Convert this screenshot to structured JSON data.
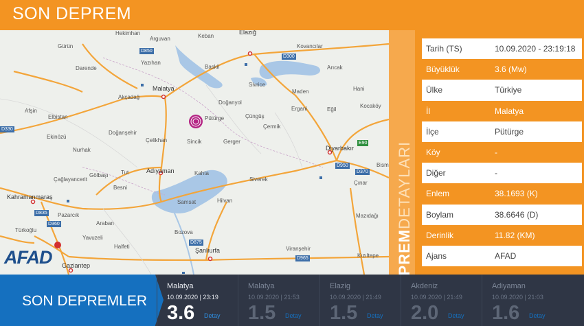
{
  "header": {
    "title": "SON DEPREM"
  },
  "map": {
    "brand": "AFAD",
    "labels": [
      "Hekimhan",
      "Arguvan",
      "Keban",
      "Elazığ",
      "Kovancılar",
      "Gürün",
      "Yazıhan",
      "Baskil",
      "Arıcak",
      "Darende",
      "Malatya",
      "Sivrice",
      "Maden",
      "Hani",
      "Akçadağ",
      "Doğanyol",
      "Ergani",
      "Eğil",
      "Kocaköy",
      "Afşin",
      "Pütürge",
      "Çüngüş",
      "Çermik",
      "Elbistan",
      "Ekinözü",
      "Doğanşehir",
      "Çelikhan",
      "Sincik",
      "Gerger",
      "Diyarbakır",
      "Nurhak",
      "Tut",
      "Adıyaman",
      "Kahta",
      "Bism",
      "Çağlayancerit",
      "Gölbaşı",
      "Besni",
      "Siverek",
      "Çınar",
      "Kahramanmaraş",
      "Hilvan",
      "Samsat",
      "Pazarcık",
      "Mazıdağı",
      "Türkoğlu",
      "Araban",
      "Yavuzeli",
      "Bozova",
      "Halfeti",
      "Viranşehir",
      "Gaziantep",
      "Şanlıurfa",
      "Kızıltepe"
    ],
    "road_badges": [
      "D850",
      "D300",
      "D330",
      "D950",
      "E90",
      "D370",
      "D835",
      "D360",
      "D875",
      "D965"
    ],
    "colors": {
      "background": "#eef0ec",
      "road": "#f3a53a",
      "water": "#a9c7e6",
      "epicenter": "#b0197e"
    }
  },
  "side": {
    "vertical_title_bold": "DEPREM",
    "vertical_title_light": "DETAYLARI"
  },
  "details": [
    {
      "label": "Tarih (TS)",
      "value": "10.09.2020 - 23:19:18"
    },
    {
      "label": "Büyüklük",
      "value": "3.6 (Mw)"
    },
    {
      "label": "Ülke",
      "value": "Türkiye"
    },
    {
      "label": "İl",
      "value": "Malatya"
    },
    {
      "label": "İlçe",
      "value": "Pütürge"
    },
    {
      "label": "Köy",
      "value": "-"
    },
    {
      "label": "Diğer",
      "value": "-"
    },
    {
      "label": "Enlem",
      "value": "38.1693 (K)"
    },
    {
      "label": "Boylam",
      "value": "38.6646 (D)"
    },
    {
      "label": "Derinlik",
      "value": "11.82 (KM)"
    },
    {
      "label": "Ajans",
      "value": "AFAD"
    }
  ],
  "footer": {
    "title": "SON DEPREMLER",
    "detail_label": "Detay",
    "quakes": [
      {
        "location": "Malatya",
        "datetime": "10.09.2020 | 23:19",
        "magnitude": "3.6"
      },
      {
        "location": "Malatya",
        "datetime": "10.09.2020 | 21:53",
        "magnitude": "1.5"
      },
      {
        "location": "Elazig",
        "datetime": "10.09.2020 | 21:49",
        "magnitude": "1.5"
      },
      {
        "location": "Akdeniz",
        "datetime": "10.09.2020 | 21:49",
        "magnitude": "2.0"
      },
      {
        "location": "Adiyaman",
        "datetime": "10.09.2020 | 21:03",
        "magnitude": "1.6"
      }
    ]
  },
  "colors": {
    "accent": "#f39422",
    "footer_bg": "#2f3645",
    "footer_title_bg": "#1570bf"
  }
}
